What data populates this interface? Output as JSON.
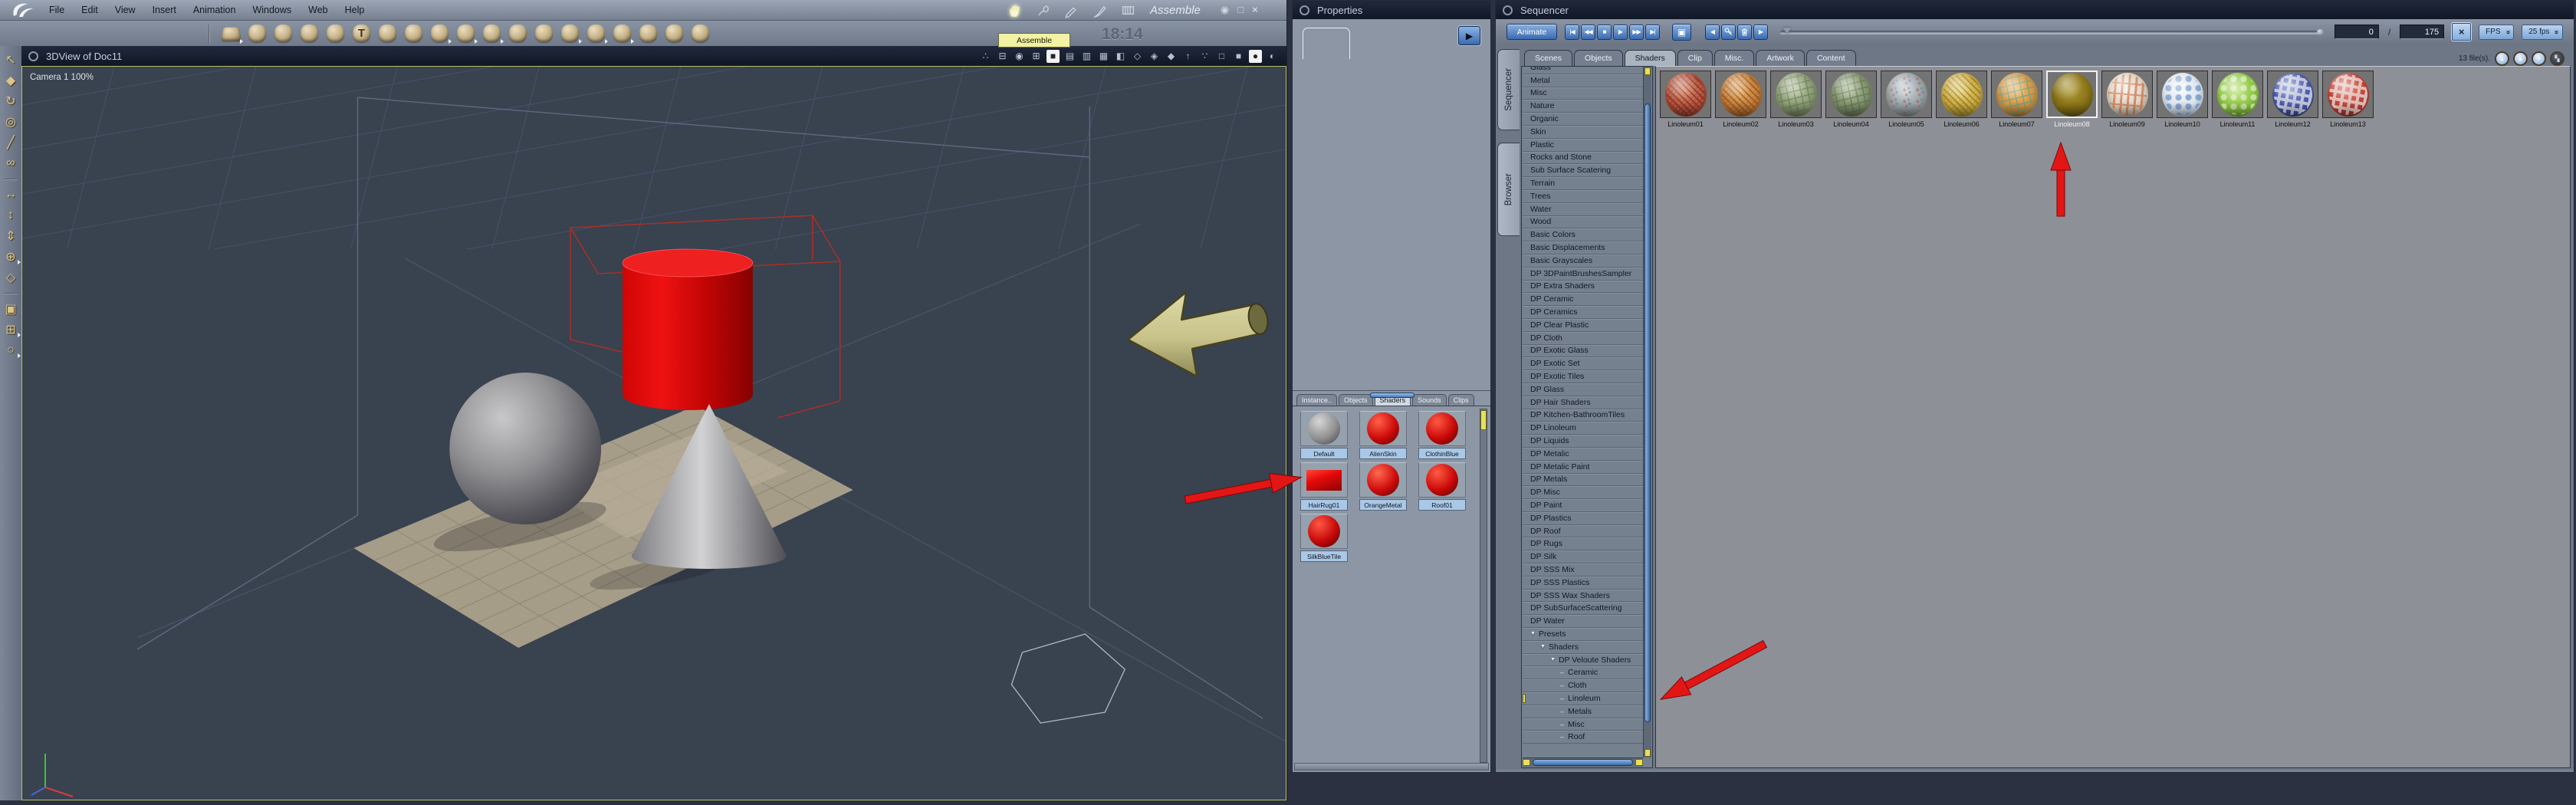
{
  "window": {
    "menus": [
      "File",
      "Edit",
      "View",
      "Insert",
      "Animation",
      "Windows",
      "Web",
      "Help"
    ],
    "mode": "Assemble",
    "time": "18:14",
    "mode_icons": [
      {
        "name": "assemble-hand-icon",
        "active": true
      },
      {
        "name": "model-wrench-icon",
        "active": false
      },
      {
        "name": "texture-pen-icon",
        "active": false
      },
      {
        "name": "paint-brush-icon",
        "active": false
      },
      {
        "name": "render-film-icon",
        "active": false
      }
    ],
    "controls": [
      {
        "name": "eye-button",
        "glyph": "◉"
      },
      {
        "name": "maximize-button",
        "glyph": "□"
      },
      {
        "name": "close-button",
        "glyph": "×"
      }
    ]
  },
  "tooltip": "Assemble",
  "object_toolbar": {
    "icons": [
      {
        "name": "floor",
        "checker": true,
        "dd": true
      },
      {
        "name": "vertex-object"
      },
      {
        "name": "sphere"
      },
      {
        "name": "metaball"
      },
      {
        "name": "spline-object"
      },
      {
        "name": "text",
        "glyph": "T"
      },
      {
        "name": "particles"
      },
      {
        "name": "terrain"
      },
      {
        "name": "tree",
        "dd": true
      },
      {
        "name": "rock",
        "dd": true
      },
      {
        "name": "fire",
        "dd": true
      },
      {
        "name": "fountain"
      },
      {
        "name": "hair"
      },
      {
        "name": "cloud",
        "dd": true
      },
      {
        "name": "light",
        "dd": true
      },
      {
        "name": "camera",
        "dd": true
      },
      {
        "name": "particle-emitter"
      },
      {
        "name": "target"
      },
      {
        "name": "bone"
      }
    ]
  },
  "tool_palette": {
    "icons": [
      {
        "name": "select",
        "glyph": "↖"
      },
      {
        "name": "scale",
        "glyph": "◆"
      },
      {
        "name": "rotate",
        "glyph": "↻"
      },
      {
        "name": "universal-manipulator",
        "glyph": "◎"
      },
      {
        "name": "eyedropper",
        "glyph": "╱"
      },
      {
        "name": "link",
        "glyph": "∞"
      },
      {
        "divider": true
      },
      {
        "name": "move-horizontal",
        "glyph": "↔"
      },
      {
        "name": "move-vertical",
        "glyph": "↕"
      },
      {
        "name": "move-depth",
        "glyph": "⇕"
      },
      {
        "name": "trackball",
        "glyph": "⊕",
        "dd": true
      },
      {
        "name": "working-box",
        "glyph": "◇"
      },
      {
        "divider": true
      },
      {
        "name": "render-preview",
        "glyph": "▣"
      },
      {
        "name": "pan",
        "glyph": "⊞",
        "dd": true
      },
      {
        "name": "zoom",
        "glyph": "○",
        "dd": true
      }
    ]
  },
  "viewport": {
    "title": "3DView of Doc11",
    "camera_label": "Camera 1 100%",
    "header_icons": [
      {
        "name": "scene-preview-spheres",
        "glyph": "∴"
      },
      {
        "name": "hierarchy",
        "glyph": "⊟"
      },
      {
        "name": "camera-list",
        "glyph": "◉"
      },
      {
        "name": "grid-settings",
        "glyph": "⊞"
      },
      {
        "name": "layout-single",
        "glyph": "■",
        "active": true
      },
      {
        "name": "layout-two-pane",
        "glyph": "▤"
      },
      {
        "name": "layout-three-pane",
        "glyph": "▥"
      },
      {
        "name": "layout-four-pane",
        "glyph": "▦"
      },
      {
        "name": "layout-custom",
        "glyph": "◧"
      },
      {
        "name": "production-frame-1",
        "glyph": "◇"
      },
      {
        "name": "production-frame-2",
        "glyph": "◈"
      },
      {
        "name": "production-frame-3",
        "glyph": "◆"
      },
      {
        "name": "camera-up",
        "glyph": "↑"
      },
      {
        "name": "level-of-detail",
        "glyph": "∵"
      },
      {
        "name": "wireframe-mode",
        "glyph": "□"
      },
      {
        "name": "flat-shading-mode",
        "glyph": "■"
      },
      {
        "name": "shaded-mode",
        "glyph": "●",
        "active": true
      },
      {
        "name": "textured-mode",
        "glyph": "◐"
      }
    ]
  },
  "properties": {
    "title": "Properties",
    "tabs": [
      {
        "label": "Instance.."
      },
      {
        "label": "Objects"
      },
      {
        "label": "Shaders",
        "selected": true
      },
      {
        "label": "Sounds"
      },
      {
        "label": "Clips"
      }
    ],
    "swatches": [
      {
        "label": "Default",
        "kind": "sphere",
        "hi": "#d6d6d6",
        "base": "#909092",
        "lo": "#3e3e44"
      },
      {
        "label": "AlienSkin",
        "kind": "sphere",
        "hi": "#ff6148",
        "base": "#cd0a0a",
        "lo": "#4c0302"
      },
      {
        "label": "ClothinBlue",
        "kind": "sphere",
        "hi": "#ff5a42",
        "base": "#c80808",
        "lo": "#480302"
      },
      {
        "label": "HairRug01",
        "kind": "rect",
        "hi": "#ff4a3a",
        "base": "#e60a0a",
        "lo": "#8a0404"
      },
      {
        "label": "OrangeMetal",
        "kind": "sphere",
        "hi": "#ff6a50",
        "base": "#d00c0c",
        "lo": "#500402"
      },
      {
        "label": "Roof01",
        "kind": "sphere",
        "hi": "#ff5c44",
        "base": "#ca0909",
        "lo": "#470302"
      },
      {
        "label": "SilkBlueTile",
        "kind": "sphere",
        "hi": "#ff5846",
        "base": "#c60808",
        "lo": "#450302"
      }
    ]
  },
  "sequencer": {
    "title": "Sequencer",
    "animate": "Animate",
    "transport": [
      {
        "name": "go-to-start",
        "glyph": "|◀"
      },
      {
        "name": "rewind",
        "glyph": "◀◀"
      },
      {
        "name": "stop",
        "glyph": "■"
      },
      {
        "name": "play",
        "glyph": "▶"
      },
      {
        "name": "fast-forward",
        "glyph": "▶▶"
      },
      {
        "name": "go-to-end",
        "glyph": "▶|"
      }
    ],
    "preview_button": {
      "name": "preview-window",
      "glyph": "▣"
    },
    "key_tools": [
      {
        "name": "previous-keyframe",
        "glyph": "◀"
      },
      {
        "name": "add-keyframe",
        "shape": "key"
      },
      {
        "name": "delete-keyframe",
        "shape": "trash"
      },
      {
        "name": "next-keyframe",
        "glyph": "▶"
      }
    ],
    "frame_current": "0",
    "frame_sep": "/",
    "frame_total": "175",
    "fps_mode": "FPS",
    "fps_value": "25 fps",
    "side_tabs": [
      {
        "label": "Sequencer"
      },
      {
        "label": "Browser",
        "selected": true
      }
    ],
    "browser": {
      "tabs": [
        {
          "label": "Scenes"
        },
        {
          "label": "Objects"
        },
        {
          "label": "Shaders",
          "selected": true
        },
        {
          "label": "Clip"
        },
        {
          "label": "Misc."
        },
        {
          "label": "Artwork"
        },
        {
          "label": "Content"
        }
      ],
      "file_count": "13 file(s).",
      "view_buttons": [
        {
          "name": "small-icons-view",
          "glyph": "▴"
        },
        {
          "name": "large-icons-view",
          "glyph": "▲"
        },
        {
          "name": "list-view",
          "glyph": "≡"
        },
        {
          "name": "browser-menu",
          "glyph": "▚",
          "dark": true
        }
      ],
      "categories": [
        {
          "label": "Glass"
        },
        {
          "label": "Metal"
        },
        {
          "label": "Misc"
        },
        {
          "label": "Nature"
        },
        {
          "label": "Organic"
        },
        {
          "label": "Skin"
        },
        {
          "label": "Plastic"
        },
        {
          "label": "Rocks and Stone"
        },
        {
          "label": "Sub Surface Scatering"
        },
        {
          "label": "Terrain"
        },
        {
          "label": "Trees"
        },
        {
          "label": "Water"
        },
        {
          "label": "Wood"
        },
        {
          "label": "Basic Colors"
        },
        {
          "label": "Basic Displacements"
        },
        {
          "label": "Basic Grayscales"
        },
        {
          "label": "DP 3DPaintBrushesSampler"
        },
        {
          "label": "DP  Extra Shaders"
        },
        {
          "label": "DP Ceramic"
        },
        {
          "label": "DP Ceramics"
        },
        {
          "label": "DP Clear Plastic"
        },
        {
          "label": "DP Cloth"
        },
        {
          "label": "DP Exotic Glass"
        },
        {
          "label": "DP Exotic Set"
        },
        {
          "label": "DP Exotic Tiles"
        },
        {
          "label": "DP Glass"
        },
        {
          "label": "DP Hair Shaders"
        },
        {
          "label": "DP Kitchen-BathroomTiles"
        },
        {
          "label": "DP Linoleum"
        },
        {
          "label": "DP Liquids"
        },
        {
          "label": "DP Metalic"
        },
        {
          "label": "DP Metalic Paint"
        },
        {
          "label": "DP Metals"
        },
        {
          "label": "DP Misc"
        },
        {
          "label": "DP Paint"
        },
        {
          "label": "DP Plastics"
        },
        {
          "label": "DP Roof"
        },
        {
          "label": "DP Rugs"
        },
        {
          "label": "DP Silk"
        },
        {
          "label": "DP SSS Mix"
        },
        {
          "label": "DP SSS Plastics"
        },
        {
          "label": "DP SSS Wax Shaders"
        },
        {
          "label": "DP SubSurfaceScattering"
        },
        {
          "label": "DP Water"
        },
        {
          "label": "Presets",
          "arrow": true
        },
        {
          "label": "Shaders",
          "arrow": true,
          "indent": 1
        },
        {
          "label": "DP Veloute Shaders",
          "arrow": true,
          "indent": 2
        },
        {
          "label": "Ceramic",
          "indent": 3,
          "leaf": true
        },
        {
          "label": "Cloth",
          "indent": 3,
          "leaf": true
        },
        {
          "label": "Linoleum",
          "indent": 3,
          "leaf": true,
          "marked": true
        },
        {
          "label": "Metals",
          "indent": 3,
          "leaf": true
        },
        {
          "label": "Misc",
          "indent": 3,
          "leaf": true
        },
        {
          "label": "Roof",
          "indent": 3,
          "leaf": true
        }
      ],
      "files": [
        {
          "label": "Linoleum01",
          "hi": "#dd8a66",
          "base": "#b14f3a",
          "lo": "#571f12",
          "acc": "#7e2c1c",
          "pattern": "mosaic"
        },
        {
          "label": "Linoleum02",
          "hi": "#e8af62",
          "base": "#c17a36",
          "lo": "#64350f",
          "acc": "#8c4c18",
          "pattern": "mosaic"
        },
        {
          "label": "Linoleum03",
          "hi": "#bac7a2",
          "base": "#8c9c74",
          "lo": "#434f33",
          "acc": "#5c7050",
          "pattern": "tiles"
        },
        {
          "label": "Linoleum04",
          "hi": "#b2c29c",
          "base": "#80916c",
          "lo": "#3c4830",
          "acc": "#556848",
          "pattern": "tiles"
        },
        {
          "label": "Linoleum05",
          "hi": "#ced4d6",
          "base": "#9aa2a4",
          "lo": "#4e5558",
          "acc": "#b4574a",
          "pattern": "speckle"
        },
        {
          "label": "Linoleum06",
          "hi": "#ecd272",
          "base": "#c9a93e",
          "lo": "#6a5614",
          "acc": "#8a7220",
          "pattern": "mosaic"
        },
        {
          "label": "Linoleum07",
          "hi": "#f0c47e",
          "base": "#d29646",
          "lo": "#6e4716",
          "acc": "#4f9e8e",
          "pattern": "tiles"
        },
        {
          "label": "Linoleum08",
          "hi": "#af9a38",
          "base": "#8a7418",
          "lo": "#3e3406",
          "acc": "#8a7418",
          "pattern": "solid",
          "selected": true
        },
        {
          "label": "Linoleum09",
          "hi": "#f4efe6",
          "base": "#ddd3c4",
          "lo": "#77695a",
          "acc": "#cc5c28",
          "pattern": "stripes"
        },
        {
          "label": "Linoleum10",
          "hi": "#f6f9fb",
          "base": "#dde5ec",
          "lo": "#6d7f99",
          "acc": "#4f7fc0",
          "pattern": "circles"
        },
        {
          "label": "Linoleum11",
          "hi": "#c4e68a",
          "base": "#90c845",
          "lo": "#426d1a",
          "acc": "#eef6e4",
          "pattern": "circles"
        },
        {
          "label": "Linoleum12",
          "hi": "#8d99ce",
          "base": "#4d5ca8",
          "lo": "#1f2857",
          "acc": "#dadeea",
          "pattern": "squares"
        },
        {
          "label": "Linoleum13",
          "hi": "#e28273",
          "base": "#c1463a",
          "lo": "#5c1b15",
          "acc": "#ead9d5",
          "pattern": "squares"
        }
      ]
    }
  }
}
